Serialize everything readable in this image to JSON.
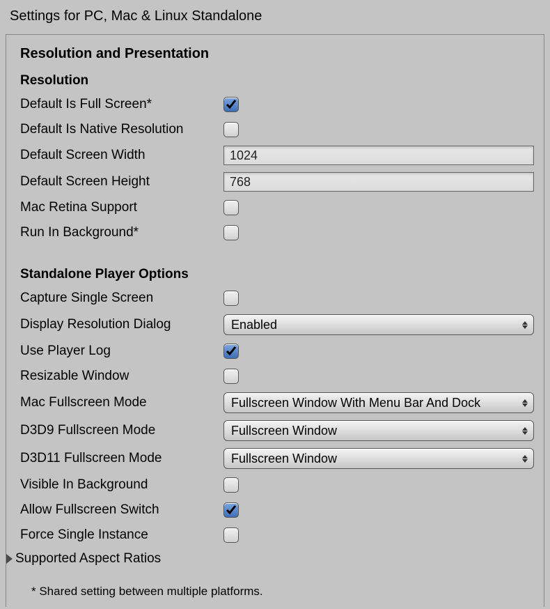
{
  "title": "Settings for PC, Mac & Linux Standalone",
  "sectionTitle": "Resolution and Presentation",
  "resolution": {
    "header": "Resolution",
    "fullscreen_label": "Default Is Full Screen*",
    "fullscreen_checked": "true",
    "native_label": "Default Is Native Resolution",
    "native_checked": "false",
    "width_label": "Default Screen Width",
    "width_value": "1024",
    "height_label": "Default Screen Height",
    "height_value": "768",
    "retina_label": "Mac Retina Support",
    "retina_checked": "false",
    "runbg_label": "Run In Background*",
    "runbg_checked": "false"
  },
  "player": {
    "header": "Standalone Player Options",
    "capture_label": "Capture Single Screen",
    "capture_checked": "false",
    "dialog_label": "Display Resolution Dialog",
    "dialog_value": "Enabled",
    "playerlog_label": "Use Player Log",
    "playerlog_checked": "true",
    "resizable_label": "Resizable Window",
    "resizable_checked": "false",
    "macfs_label": "Mac Fullscreen Mode",
    "macfs_value": "Fullscreen Window With Menu Bar And Dock",
    "d3d9_label": "D3D9 Fullscreen Mode",
    "d3d9_value": "Fullscreen Window",
    "d3d11_label": "D3D11 Fullscreen Mode",
    "d3d11_value": "Fullscreen Window",
    "visiblebg_label": "Visible In Background",
    "visiblebg_checked": "false",
    "allowfs_label": "Allow Fullscreen Switch",
    "allowfs_checked": "true",
    "single_label": "Force Single Instance",
    "single_checked": "false",
    "aspect_label": "Supported Aspect Ratios"
  },
  "footnote": "* Shared setting between multiple platforms."
}
